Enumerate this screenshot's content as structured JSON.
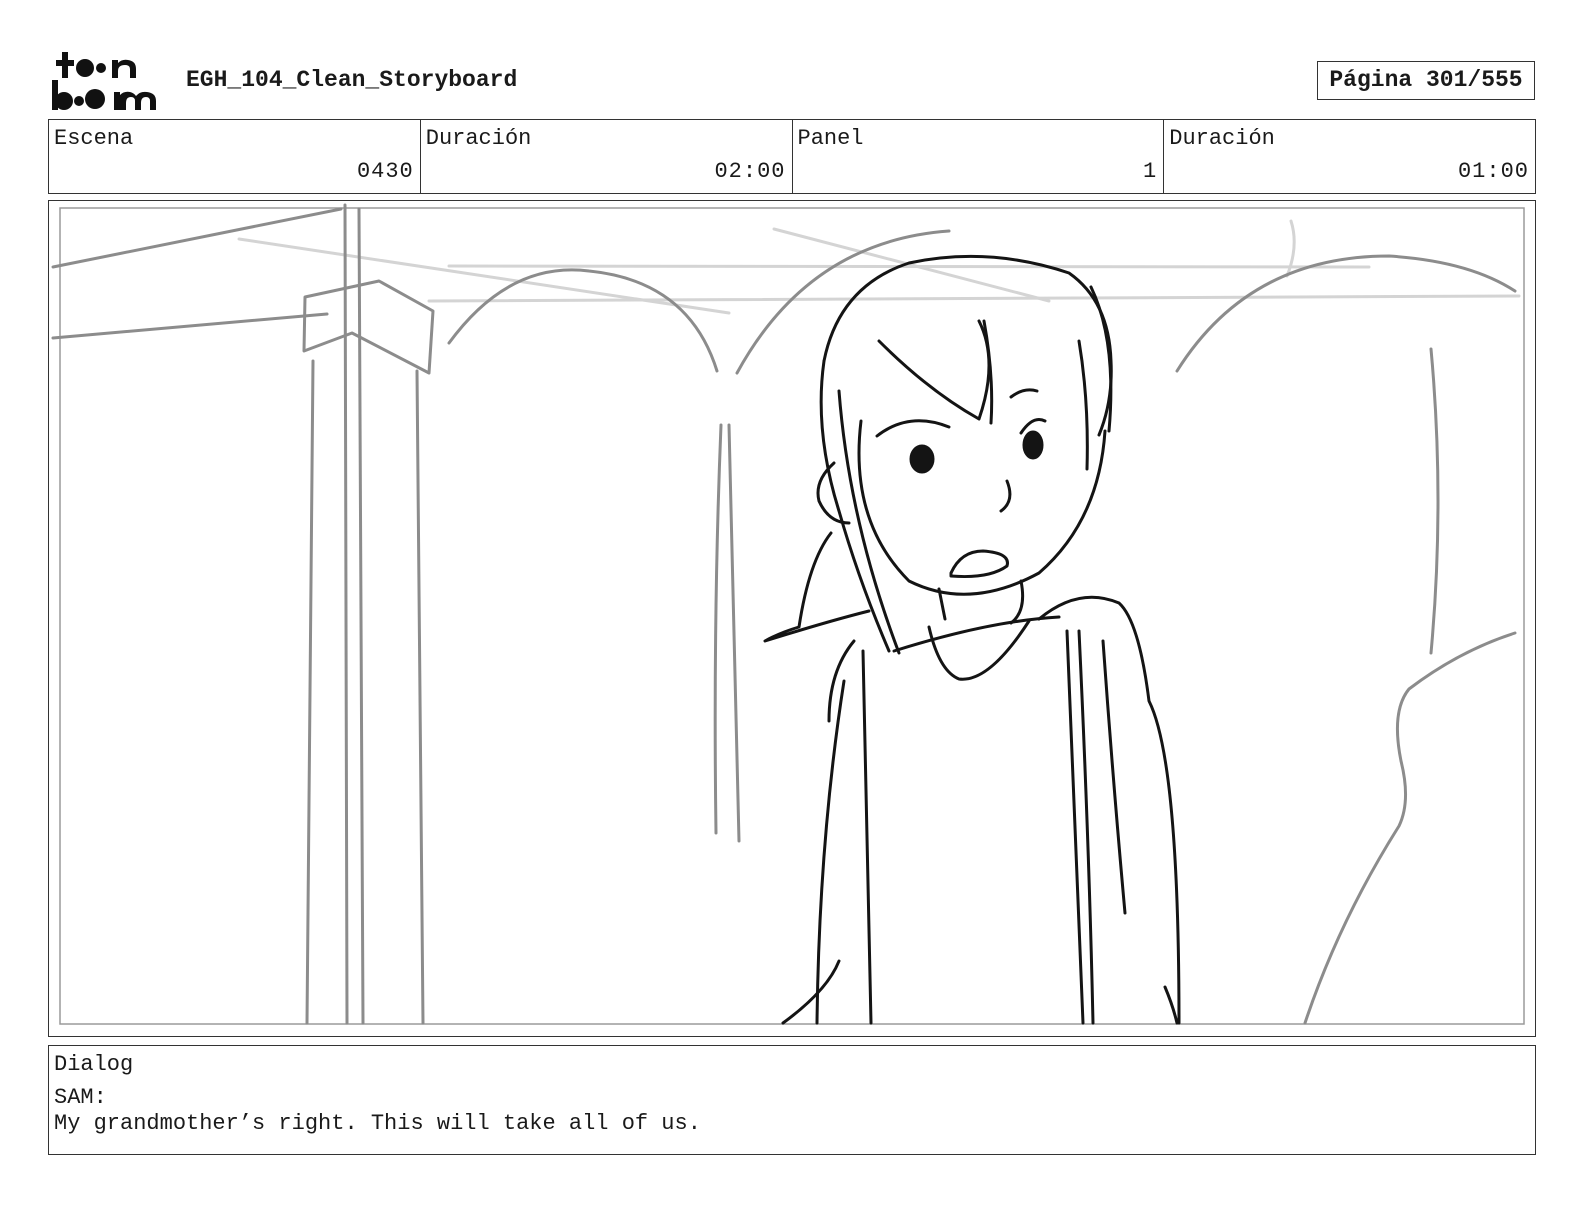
{
  "header": {
    "logo_text": "toon boom",
    "title": "EGH_104_Clean_Storyboard",
    "page": "Página 301/555"
  },
  "info": {
    "scene_label": "Escena",
    "scene_value": "0430",
    "scene_duration_label": "Duración",
    "scene_duration_value": "02:00",
    "panel_label": "Panel",
    "panel_value": "1",
    "panel_duration_label": "Duración",
    "panel_duration_value": "01:00"
  },
  "dialog": {
    "label": "Dialog",
    "speaker": "SAM:",
    "line": "My grandmother’s right. This will take all of us."
  },
  "colors": {
    "ink": "#1a1a1a",
    "border": "#333333",
    "sketch_gray": "#8a8a8a",
    "sketch_light": "#cfcfcf"
  }
}
